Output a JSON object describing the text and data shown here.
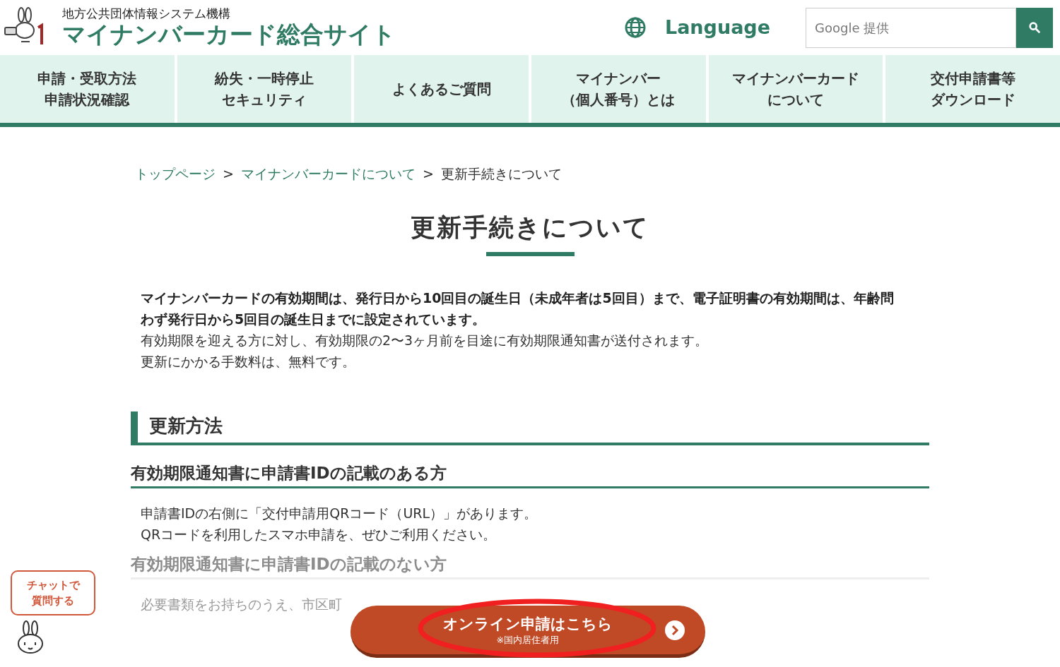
{
  "header": {
    "org": "地方公共団体情報システム機構",
    "site_title": "マイナンバーカード総合サイト",
    "language": "Language",
    "search": {
      "placeholder": "Google 提供"
    }
  },
  "nav": [
    {
      "lines": [
        "申請・受取方法",
        "申請状況確認"
      ]
    },
    {
      "lines": [
        "紛失・一時停止",
        "セキュリティ"
      ]
    },
    {
      "lines": [
        "よくあるご質問"
      ]
    },
    {
      "lines": [
        "マイナンバー",
        "（個人番号）とは"
      ]
    },
    {
      "lines": [
        "マイナンバーカード",
        "について"
      ]
    },
    {
      "lines": [
        "交付申請書等",
        "ダウンロード"
      ]
    }
  ],
  "breadcrumb": {
    "separator": ">",
    "items": [
      {
        "label": "トップページ",
        "link": true
      },
      {
        "label": "マイナンバーカードについて",
        "link": true
      },
      {
        "label": "更新手続きについて",
        "link": false
      }
    ]
  },
  "page_title": "更新手続きについて",
  "intro": [
    {
      "text": "マイナンバーカードの有効期間は、発行日から10回目の誕生日（未成年者は5回目）まで、電子証明書の有効期間は、年齢問わず発行日から5回目の誕生日までに設定されています。",
      "bold": true
    },
    {
      "text": "有効期限を迎える方に対し、有効期限の2〜3ヶ月前を目途に有効期限通知書が送付されます。",
      "bold": false
    },
    {
      "text": "更新にかかる手数料は、無料です。",
      "bold": false
    }
  ],
  "sections": [
    {
      "kind": "h2",
      "text": "更新方法",
      "faded": false
    },
    {
      "kind": "h3",
      "text": "有効期限通知書に申請書IDの記載のある方",
      "faded": false
    },
    {
      "kind": "p",
      "text": "申請書IDの右側に「交付申請用QRコード（URL）」があります。",
      "faded": false
    },
    {
      "kind": "p",
      "text": "QRコードを利用したスマホ申請を、ぜひご利用ください。",
      "faded": false
    },
    {
      "kind": "h3",
      "text": "有効期限通知書に申請書IDの記載のない方",
      "faded": true
    },
    {
      "kind": "p",
      "text": "必要書類をお持ちのうえ、市区町",
      "faded": true
    }
  ],
  "chat": {
    "lines": [
      "チャットで",
      "質問する"
    ]
  },
  "cta": {
    "title": "オンライン申請はこちら",
    "note": "※国内居住者用",
    "highlighted": true
  }
}
